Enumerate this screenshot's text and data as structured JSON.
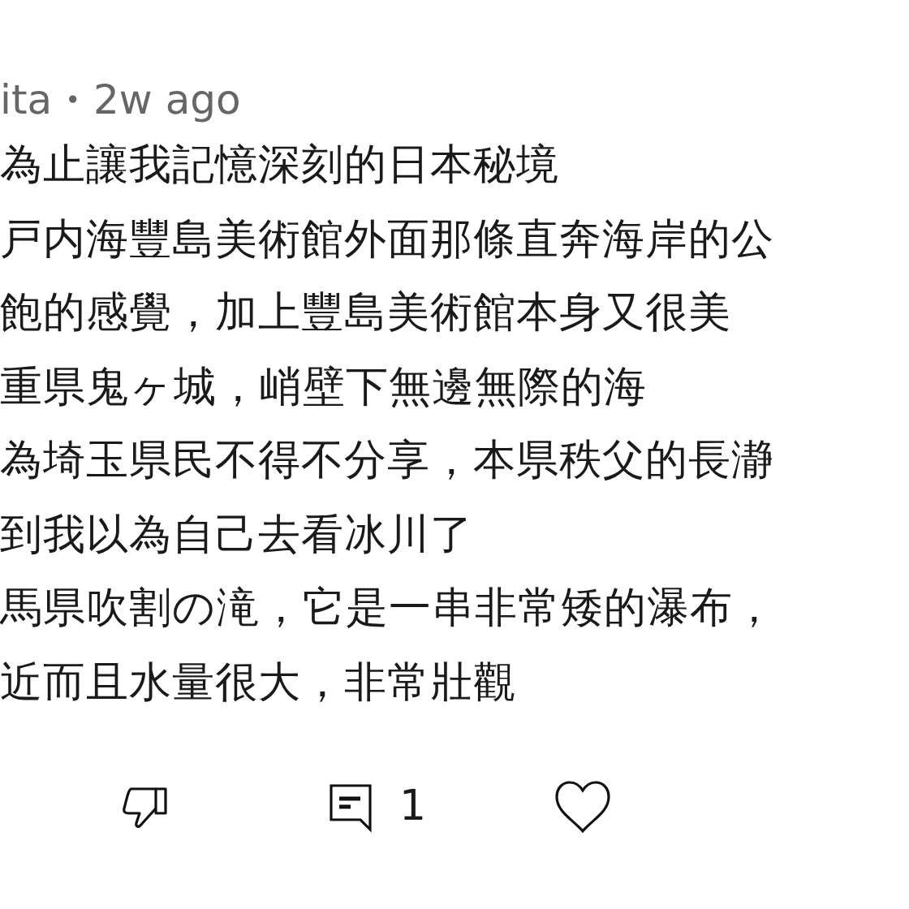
{
  "comment": {
    "author": "ita",
    "separator": "•",
    "time": "2w ago",
    "lines": [
      "為止讓我記憶深刻的日本秘境",
      "戸内海豐島美術館外面那條直奔海岸的公",
      "飽的感覺，加上豐島美術館本身又很美",
      "重県鬼ヶ城，峭壁下無邊無際的海",
      "為埼玉県民不得不分享，本県秩父的長瀞",
      "到我以為自己去看冰川了",
      "馬県吹割の滝，它是一串非常矮的瀑布，",
      "近而且水量很大，非常壯觀"
    ]
  },
  "actions": {
    "reply_count": "1"
  }
}
